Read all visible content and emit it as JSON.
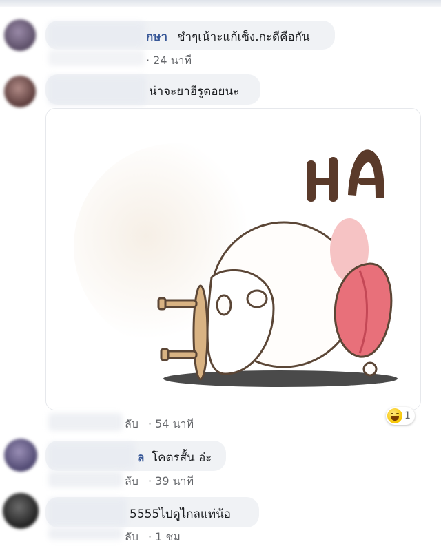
{
  "comments": [
    {
      "name_visible": "กษา",
      "text": "ชำๆเน้าะแก้เซ็ง.กะดีคือกัน",
      "time": "· 24 นาที"
    },
    {
      "name_visible": "",
      "text": "น่าจะยาฮีรูดอยนะ",
      "time": ""
    },
    {
      "name_visible": "",
      "text": "",
      "sticker_text": "HA",
      "reply_partial": "ลับ",
      "time": "· 54 นาที",
      "reaction_count": "1"
    },
    {
      "name_visible": "ล",
      "text": "โคตรสั้น อ่ะ",
      "reply_partial": "ลับ",
      "time": "· 39 นาที"
    },
    {
      "name_visible": "",
      "text": "5555ไปดูไกลแท่น้อ",
      "reply_partial": "ลับ",
      "time": "· 1 ชม"
    }
  ],
  "colors": {
    "name": "#385898",
    "bubble": "#f0f2f5",
    "meta": "#65676b",
    "sticker_letters": "#5a3a2a",
    "sticker_pink": "#e86b7a"
  },
  "icons": [
    "haha-reaction-icon"
  ]
}
